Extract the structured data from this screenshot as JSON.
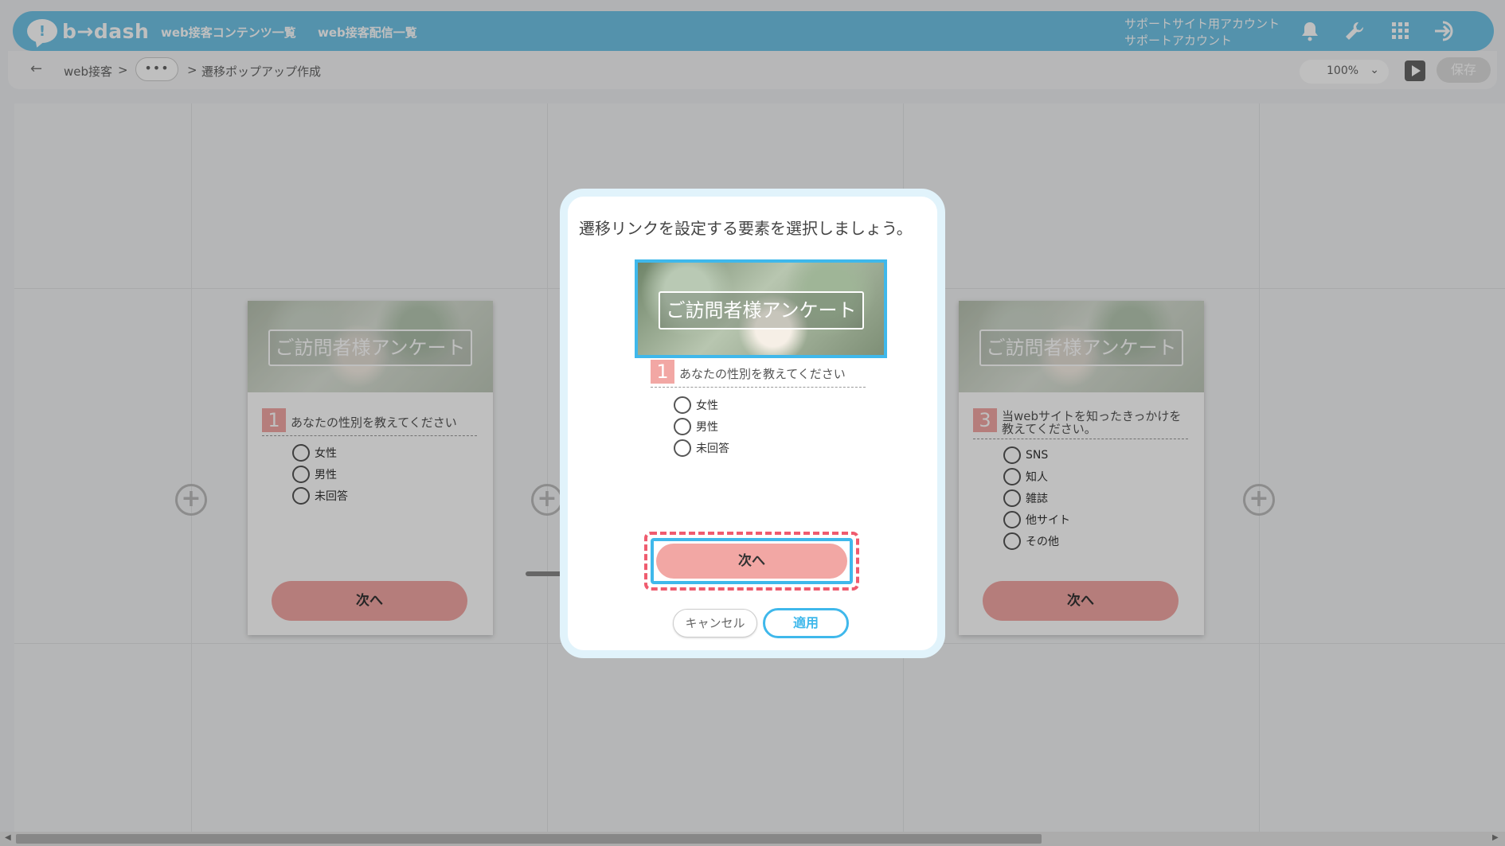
{
  "header": {
    "logo_mark": "!",
    "logo_text": "b→dash",
    "nav": [
      "web接客コンテンツ一覧",
      "web接客配信一覧"
    ],
    "account_line1": "サポートサイト用アカウント",
    "account_line2": "サポートアカウント",
    "icons": [
      "bell-icon",
      "wrench-icon",
      "grid-icon",
      "logout-icon"
    ]
  },
  "toolbar": {
    "back": "←",
    "breadcrumb": [
      "web接客",
      "遷移ポップアップ作成"
    ],
    "separator": ">",
    "more": "•••",
    "zoom": "100%",
    "zoom_chevron": "⌄",
    "save": "保存"
  },
  "cards": [
    {
      "title": "ご訪問者様アンケート",
      "q_number": "1",
      "question": "あなたの性別を教えてください",
      "options": [
        "女性",
        "男性",
        "未回答"
      ],
      "button": "次へ"
    },
    {
      "title": "ご訪問者様アンケート",
      "q_number": "3",
      "question": "当webサイトを知ったきっかけを教えてください。",
      "options": [
        "SNS",
        "知人",
        "雑誌",
        "他サイト",
        "その他"
      ],
      "button": "次へ"
    }
  ],
  "plus_symbol": "+",
  "modal": {
    "title": "遷移リンクを設定する要素を選択しましょう。",
    "card_title": "ご訪問者様アンケート",
    "q_number": "1",
    "question": "あなたの性別を教えてください",
    "options": [
      "女性",
      "男性",
      "未回答"
    ],
    "next_button": "次へ",
    "cancel": "キャンセル",
    "apply": "適用"
  },
  "colors": {
    "header": "#71c3e6",
    "accent_blue": "#3fb8eb",
    "button_pink": "#f2a7a4",
    "selection_red": "#ef5b6e"
  }
}
